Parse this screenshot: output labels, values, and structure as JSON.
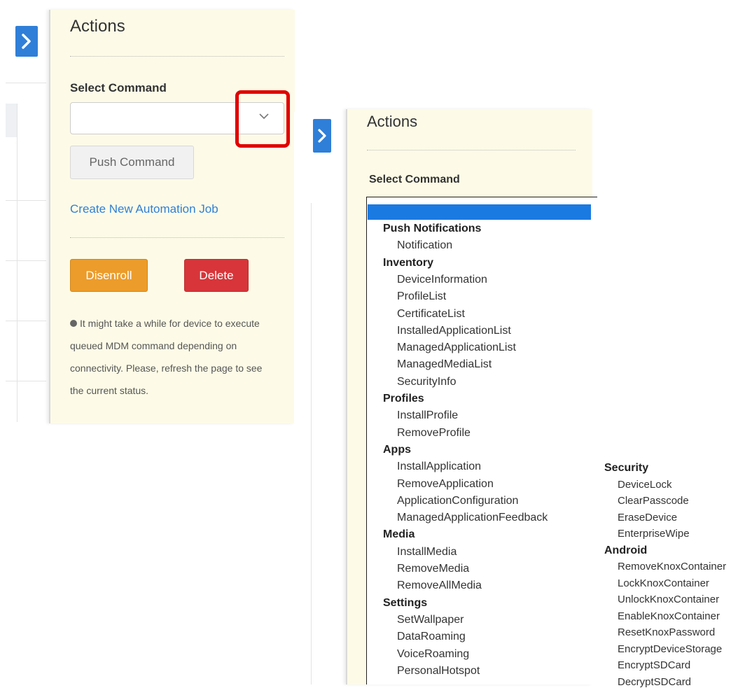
{
  "panel_a": {
    "title": "Actions",
    "select_label": "Select Command",
    "select_value": "",
    "push_label": "Push Command",
    "automation_link": "Create New Automation Job",
    "disenroll_label": "Disenroll",
    "delete_label": "Delete",
    "note": "It might take a while for device to execute queued MDM command depending on connectivity. Please, refresh the page to see the current status."
  },
  "panel_b": {
    "title": "Actions",
    "select_label": "Select Command",
    "groups": [
      {
        "label": "Push Notifications",
        "items": [
          "Notification"
        ]
      },
      {
        "label": "Inventory",
        "items": [
          "DeviceInformation",
          "ProfileList",
          "CertificateList",
          "InstalledApplicationList",
          "ManagedApplicationList",
          "ManagedMediaList",
          "SecurityInfo"
        ]
      },
      {
        "label": "Profiles",
        "items": [
          "InstallProfile",
          "RemoveProfile"
        ]
      },
      {
        "label": "Apps",
        "items": [
          "InstallApplication",
          "RemoveApplication",
          "ApplicationConfiguration",
          "ManagedApplicationFeedback"
        ]
      },
      {
        "label": "Media",
        "items": [
          "InstallMedia",
          "RemoveMedia",
          "RemoveAllMedia"
        ]
      },
      {
        "label": "Settings",
        "items": [
          "SetWallpaper",
          "DataRoaming",
          "VoiceRoaming",
          "PersonalHotspot"
        ]
      }
    ],
    "groups_right": [
      {
        "label": "Security",
        "items": [
          "DeviceLock",
          "ClearPasscode",
          "EraseDevice",
          "EnterpriseWipe"
        ]
      },
      {
        "label": "Android",
        "items": [
          "RemoveKnoxContainer",
          "LockKnoxContainer",
          "UnlockKnoxContainer",
          "EnableKnoxContainer",
          "ResetKnoxPassword",
          "EncryptDeviceStorage",
          "EncryptSDCard",
          "DecryptSDCard"
        ]
      }
    ]
  },
  "colors": {
    "accent": "#2f7fd8",
    "disenroll": "#ec9c2a",
    "delete": "#d7353a",
    "highlight": "#e00000",
    "panel_bg": "#fdfbe7"
  }
}
